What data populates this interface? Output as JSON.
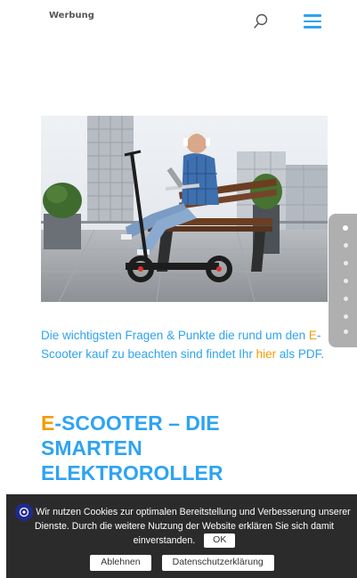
{
  "header": {
    "brand": "Werbung",
    "search_icon": "search-icon",
    "menu_icon": "hamburger-menu-icon",
    "accent_color": "#2ea3f2"
  },
  "hero": {
    "image": "man-with-headphones-and-laptop-sitting-on-bench-next-to-e-scooter"
  },
  "dot_nav": {
    "count": 7,
    "active_index": 0
  },
  "intro": {
    "part1": "Die wichtigsten Fragen & Punkte die rund um den ",
    "e": "E",
    "part2": "-Scooter kauf zu beachten sind findet Ihr ",
    "link": "hier",
    "part3": " als PDF.",
    "text_color": "#2ea3f2",
    "highlight_color": "#f59b00"
  },
  "headline": {
    "e": "E",
    "rest": "-Scooter – die smarten Elektroroller"
  },
  "cookie": {
    "text_main": "Wir nutzen Cookies zur optimalen Bereitstellung und Verbesserung unserer Dienste. Durch die weitere Nutzung der Website erklären Sie sich damit einverstanden.",
    "ok_label": "OK",
    "decline_label": "Ablehnen",
    "privacy_label": "Datenschutzerklärung",
    "background": "#2b2b2b"
  }
}
